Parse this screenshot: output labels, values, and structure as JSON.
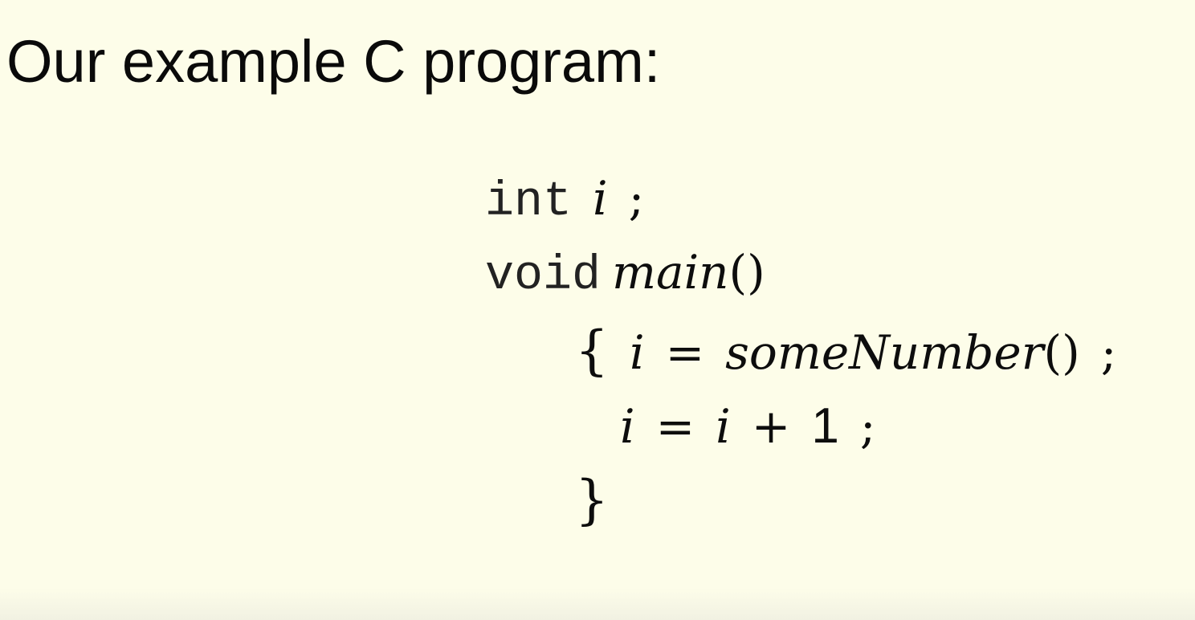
{
  "slide": {
    "title": "Our example C program:"
  },
  "code": {
    "line1": {
      "keyword": "int",
      "var": "i",
      "semi": ";"
    },
    "line2": {
      "keyword": "void",
      "func": "main",
      "parens": "()"
    },
    "line3": {
      "open_brace": "{",
      "var": "i",
      "eq": "=",
      "func": "someNumber",
      "parens": "()",
      "semi": ";"
    },
    "line4": {
      "var": "i",
      "eq": "=",
      "var2": "i",
      "plus": "+",
      "num": "1",
      "semi": ";"
    },
    "line5": {
      "close_brace": "}"
    }
  }
}
